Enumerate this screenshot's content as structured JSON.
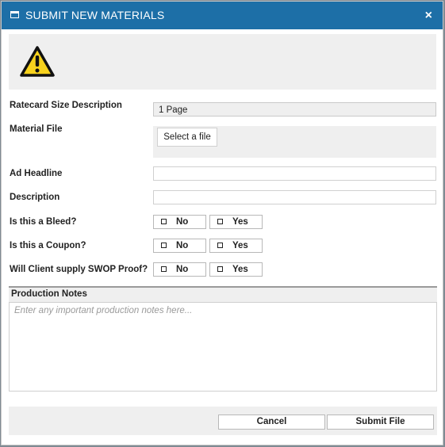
{
  "dialog": {
    "title": "SUBMIT NEW MATERIALS",
    "close_glyph": "×",
    "window_icon": "window-icon",
    "warning_icon": "warning-triangle-icon",
    "header_color": "#1d6fa7"
  },
  "form": {
    "ratecard": {
      "label": "Ratecard Size Description",
      "value": "1 Page"
    },
    "material_file": {
      "label": "Material File",
      "button": "Select a file"
    },
    "headline": {
      "label": "Ad Headline",
      "value": ""
    },
    "description": {
      "label": "Description",
      "value": ""
    },
    "bleed": {
      "label": "Is this a Bleed?",
      "no": "No",
      "yes": "Yes"
    },
    "coupon": {
      "label": "Is this a Coupon?",
      "no": "No",
      "yes": "Yes"
    },
    "swop": {
      "label": "Will Client supply SWOP Proof?",
      "no": "No",
      "yes": "Yes"
    },
    "notes": {
      "label": "Production Notes",
      "placeholder": "Enter any important production notes here..."
    }
  },
  "footer": {
    "cancel": "Cancel",
    "submit": "Submit File"
  }
}
